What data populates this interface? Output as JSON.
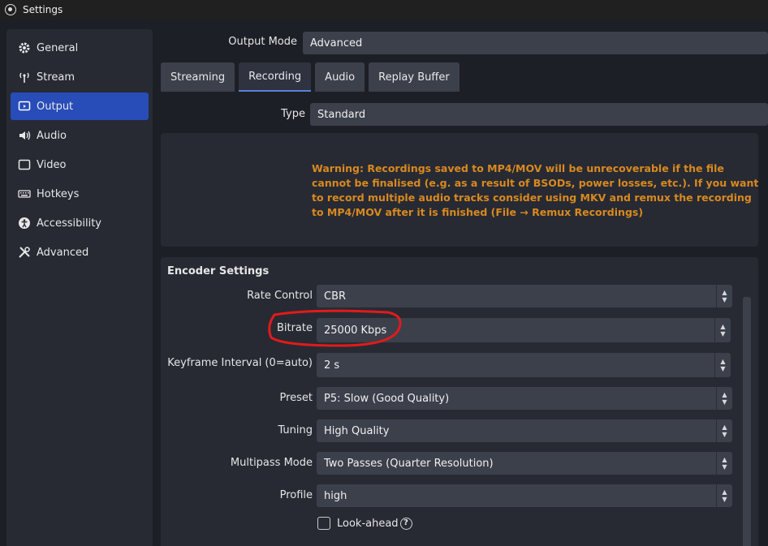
{
  "window": {
    "title": "Settings"
  },
  "sidebar": {
    "items": [
      {
        "label": "General",
        "icon": "gear-icon"
      },
      {
        "label": "Stream",
        "icon": "antenna-icon"
      },
      {
        "label": "Output",
        "icon": "output-monitor-icon"
      },
      {
        "label": "Audio",
        "icon": "speaker-icon"
      },
      {
        "label": "Video",
        "icon": "monitor-icon"
      },
      {
        "label": "Hotkeys",
        "icon": "keyboard-icon"
      },
      {
        "label": "Accessibility",
        "icon": "accessibility-icon"
      },
      {
        "label": "Advanced",
        "icon": "tools-icon"
      }
    ],
    "active_index": 2
  },
  "output_mode": {
    "label": "Output Mode",
    "value": "Advanced"
  },
  "tabs": [
    {
      "label": "Streaming"
    },
    {
      "label": "Recording"
    },
    {
      "label": "Audio"
    },
    {
      "label": "Replay Buffer"
    }
  ],
  "active_tab_index": 1,
  "type": {
    "label": "Type",
    "value": "Standard"
  },
  "warning_text": "Warning: Recordings saved to MP4/MOV will be unrecoverable if the file cannot be finalised (e.g. as a result of BSODs, power losses, etc.). If you want to record multiple audio tracks consider using MKV and remux the recording to MP4/MOV after it is finished (File → Remux Recordings)",
  "encoder": {
    "title": "Encoder Settings",
    "rate_control": {
      "label": "Rate Control",
      "value": "CBR"
    },
    "bitrate": {
      "label": "Bitrate",
      "value": "25000 Kbps"
    },
    "keyframe": {
      "label": "Keyframe Interval (0=auto)",
      "value": "2 s"
    },
    "preset": {
      "label": "Preset",
      "value": "P5: Slow (Good Quality)"
    },
    "tuning": {
      "label": "Tuning",
      "value": "High Quality"
    },
    "multipass": {
      "label": "Multipass Mode",
      "value": "Two Passes (Quarter Resolution)"
    },
    "profile": {
      "label": "Profile",
      "value": "high"
    },
    "lookahead": {
      "label": "Look-ahead",
      "checked": false
    }
  },
  "colors": {
    "accent": "#284cb8",
    "warning": "#d9891f",
    "annotation": "#e01b1b"
  }
}
